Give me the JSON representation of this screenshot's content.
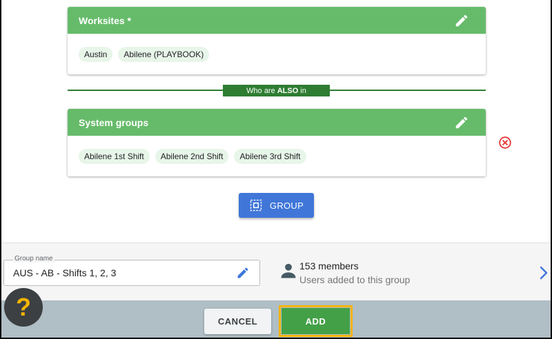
{
  "worksites_card": {
    "title": "Worksites *",
    "chips": [
      "Austin",
      "Abilene (PLAYBOOK)"
    ]
  },
  "divider": {
    "prefix": "Who are",
    "emphasis": "ALSO",
    "suffix": "in"
  },
  "system_groups_card": {
    "title": "System groups",
    "chips": [
      "Abilene 1st Shift",
      "Abilene 2nd Shift",
      "Abilene 3rd Shift"
    ]
  },
  "group_button": {
    "label": "GROUP"
  },
  "group_name": {
    "label": "Group name",
    "value": "AUS - AB - Shifts 1, 2, 3"
  },
  "members": {
    "count_text": "153 members",
    "subtitle": "Users added to this group"
  },
  "actions": {
    "cancel_label": "CANCEL",
    "add_label": "ADD"
  },
  "help": {
    "glyph": "?"
  },
  "colors": {
    "header_green": "#66bb6a",
    "divider_green": "#2e7d32",
    "primary_blue": "#3f76d8",
    "add_green": "#43a047",
    "highlight_yellow": "#f4b400",
    "remove_red": "#e53935"
  },
  "icons": {
    "edit": "pencil-icon",
    "remove": "close-circle-icon",
    "group": "select-group-icon",
    "person": "person-icon",
    "chevron": "chevron-right-icon"
  }
}
